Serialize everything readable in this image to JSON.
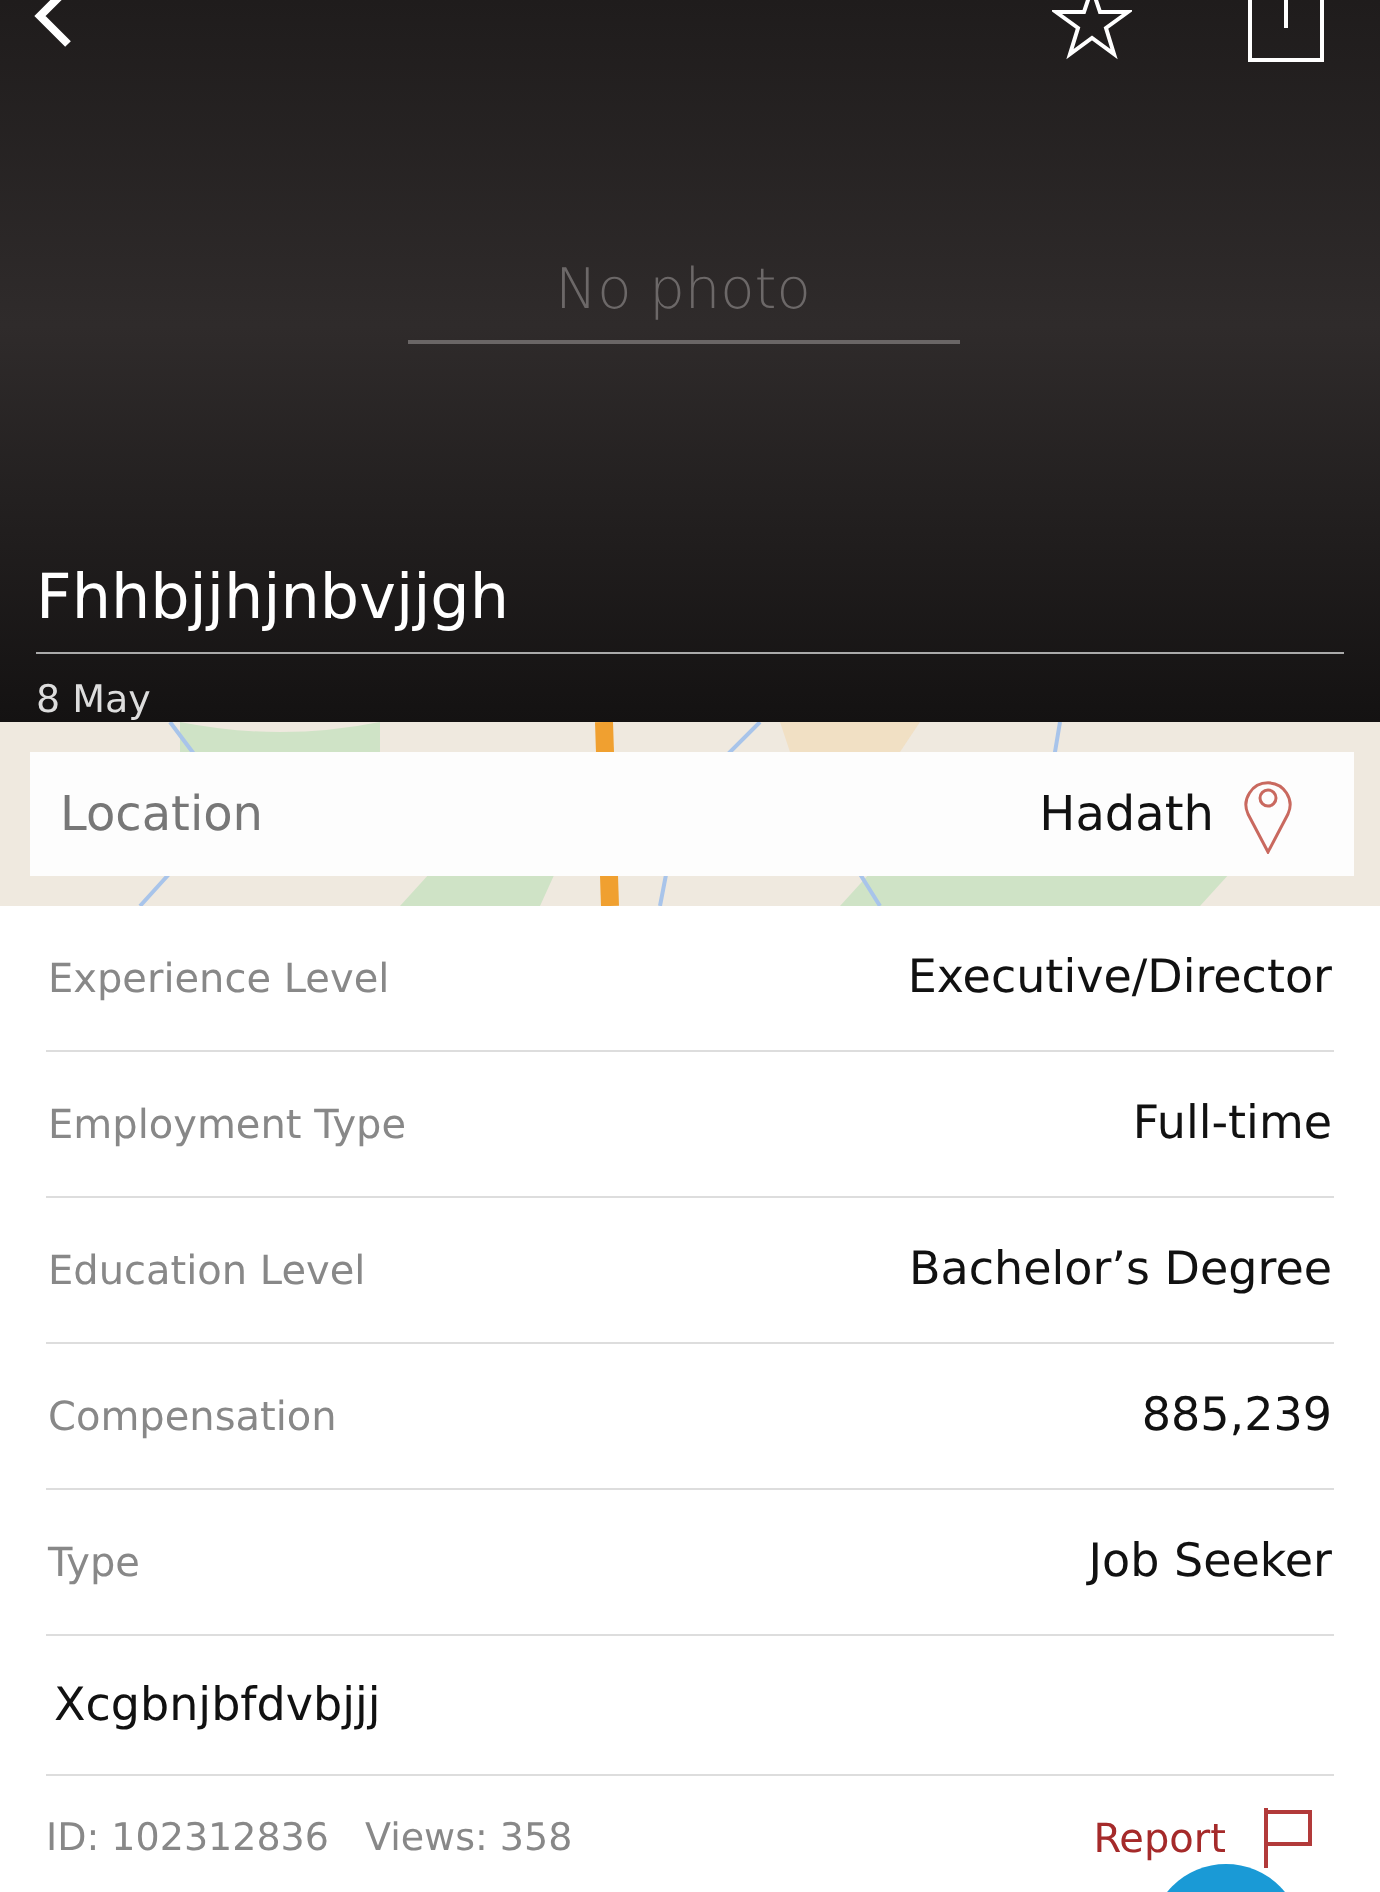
{
  "header": {
    "placeholder_text": "No photo",
    "title": "Fhhbjjhjnbvjjgh",
    "date": "8  May"
  },
  "location": {
    "label": "Location",
    "value": "Hadath"
  },
  "details": [
    {
      "label": "Experience Level",
      "value": "Executive/Director"
    },
    {
      "label": "Employment Type",
      "value": "Full-time"
    },
    {
      "label": "Education Level",
      "value": "Bachelor’s Degree"
    },
    {
      "label": "Compensation",
      "value": "885,239"
    },
    {
      "label": "Type",
      "value": "Job Seeker"
    }
  ],
  "description": "Xcgbnjbfdvbjjj",
  "footer": {
    "id": "ID: 102312836",
    "views": "Views: 358",
    "report": "Report"
  }
}
